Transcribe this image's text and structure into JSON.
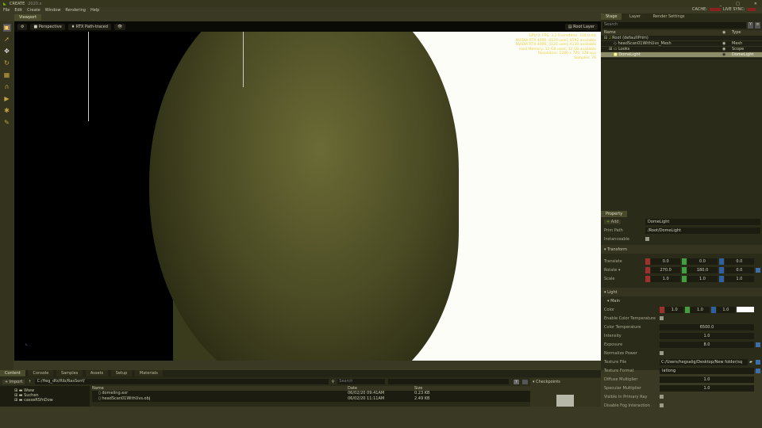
{
  "app": {
    "title": "CREATE",
    "version": "2020.x"
  },
  "window_controls": {
    "cache": "CACHE:",
    "live_sync": "LIVE SYNC:",
    "minimize": "_",
    "maximize": "□",
    "close": "✕"
  },
  "menu": [
    "File",
    "Edit",
    "Create",
    "Window",
    "Rendering",
    "Help"
  ],
  "viewport": {
    "tab": "Viewport",
    "camera": "Perspective",
    "renderer": "RTX Path-traced",
    "eye": "👁",
    "layer": "Root Layer",
    "stats": [
      "GPU 0: FPS: 3.2 Frametime: 310.0 ms",
      "NVIDIA RTX 4000: 4120 used, 8192 available",
      "NVIDIA RTX 4000: 4120 used, 4130 available",
      "Host Memory: 12 GB used, 32 GB available",
      "Resolution: 1280 x 720, 128 spp",
      "Samples: 76"
    ]
  },
  "stage": {
    "tabs": [
      "Stage",
      "Layer",
      "Render Settings"
    ],
    "search": "Search",
    "col_name": "Name",
    "col_type": "Type",
    "rows": [
      {
        "name": "Root (defaultPrim)",
        "type": ""
      },
      {
        "name": "headScan01WithUvs_Mesh",
        "type": "Mesh"
      },
      {
        "name": "Looks",
        "type": "Scope"
      },
      {
        "name": "DomeLight",
        "type": "DomeLight"
      }
    ]
  },
  "property": {
    "tab": "Property",
    "add": "Add",
    "name": "DomeLight",
    "prim_path_label": "Prim Path",
    "prim_path": "/Root/DomeLight",
    "instanceable": "Instanceable",
    "transform": "Transform",
    "translate": {
      "label": "Translate",
      "x": "0.0",
      "y": "0.0",
      "z": "0.0"
    },
    "rotate": {
      "label": "Rotate ▾",
      "x": "270.0",
      "y": "180.0",
      "z": "0.0"
    },
    "scale": {
      "label": "Scale",
      "x": "1.0",
      "y": "1.0",
      "z": "1.0"
    },
    "light": "Light",
    "main": "Main",
    "color": {
      "label": "Color",
      "r": "1.0",
      "g": "1.0",
      "b": "1.0"
    },
    "enable_color_temp": "Enable Color Temperature",
    "color_temp": {
      "label": "Color Temperature",
      "value": "6500.0"
    },
    "intensity": {
      "label": "Intensity",
      "value": "1.0"
    },
    "exposure": {
      "label": "Exposure",
      "value": "8.0"
    },
    "normalize": "Normalize Power",
    "texture_file": {
      "label": "Texture File",
      "value": "C:/Users/hegsalig/Desktop/New folder/sq"
    },
    "texture_format": {
      "label": "Texture Format",
      "value": "latlong"
    },
    "diffuse": {
      "label": "Diffuse Multiplier",
      "value": "1.0"
    },
    "specular": {
      "label": "Specular Multiplier",
      "value": "1.0"
    },
    "visible_primary": "Visible In Primary Ray",
    "fog": "Disable Fog Interaction"
  },
  "content": {
    "tabs": [
      "Content",
      "Console",
      "Samples",
      "Assets",
      "Setup",
      "Materials"
    ],
    "import": "Import",
    "path": "C:/Heg_dfz/Rib/RasSonf/",
    "search": "Search",
    "tree": [
      "Www",
      "Suchen",
      "casseRSfnDow"
    ],
    "col_name": "Name",
    "col_date": "Date",
    "col_size": "Size",
    "files": [
      {
        "name": "domeling.exr",
        "date": "06/02/20 09:41AM",
        "size": "0.23 KB"
      },
      {
        "name": "headScan01WithUvs.obj",
        "date": "06/02/20 11:11AM",
        "size": "2.49 KB"
      }
    ],
    "checkpoints": "Checkpoints"
  }
}
